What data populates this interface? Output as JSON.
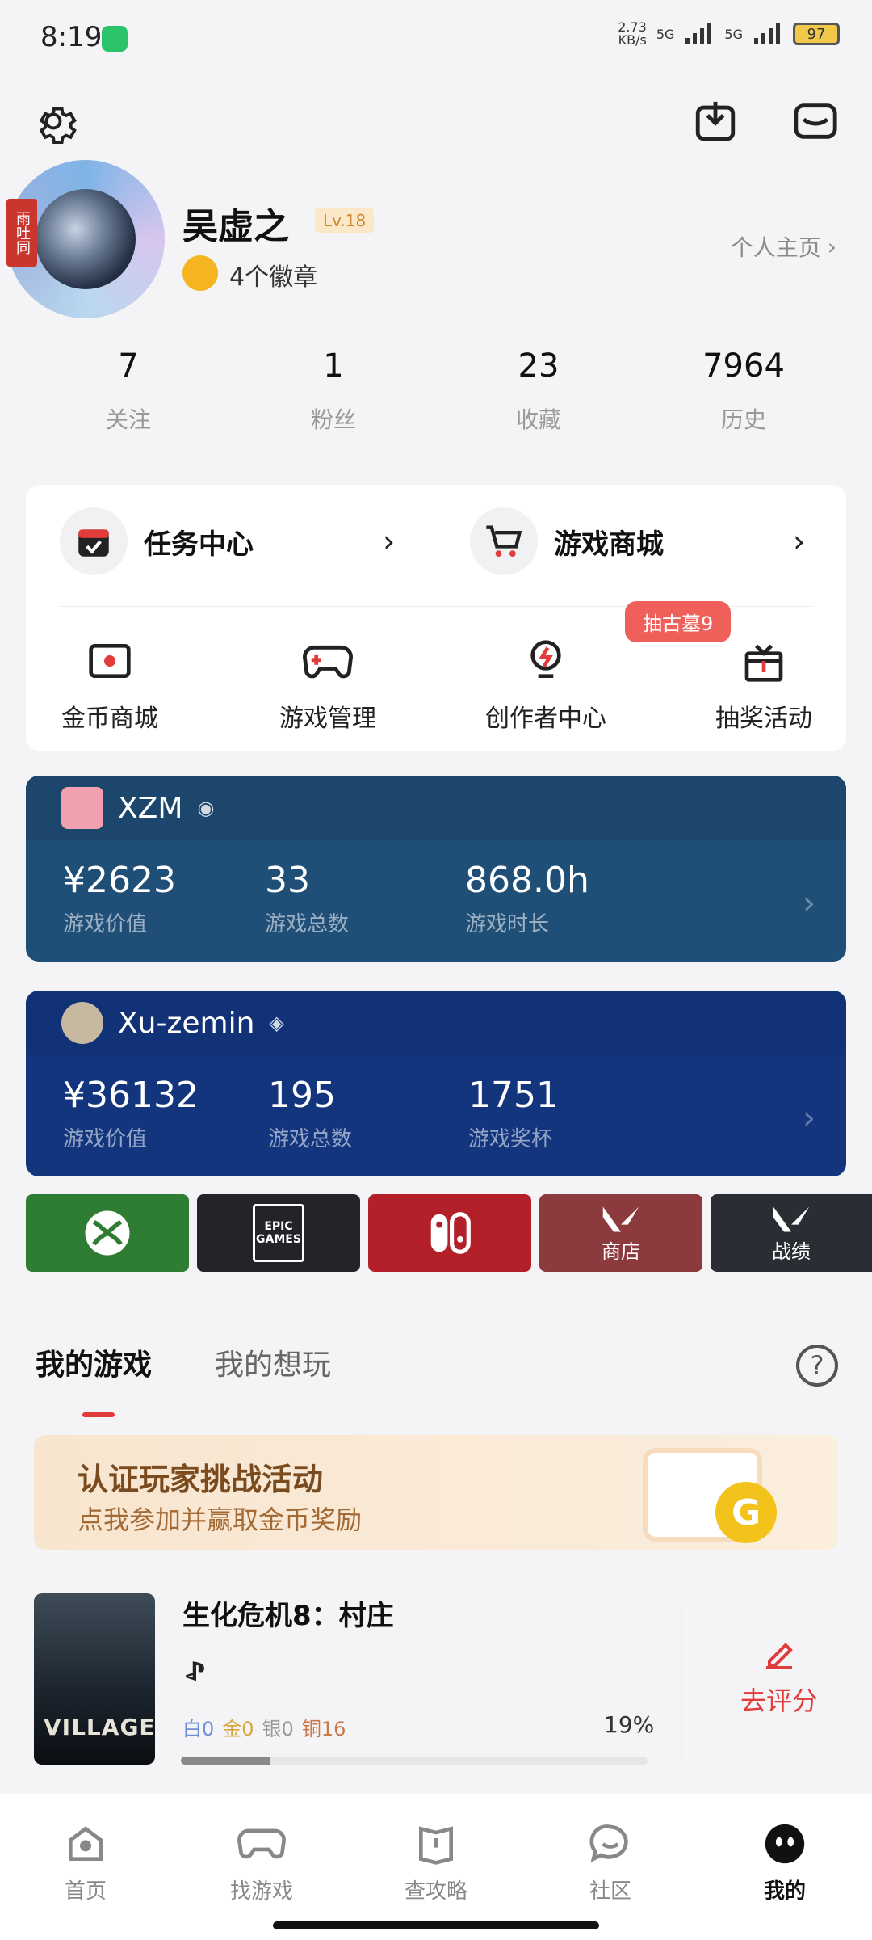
{
  "status_bar": {
    "time": "8:19",
    "net_speed_top": "2.73",
    "net_speed_unit": "KB/s",
    "sim1": "5G",
    "sim2": "5G",
    "battery": "97"
  },
  "profile": {
    "username": "吴虚之",
    "level": "Lv.18",
    "badges": "4个徽章",
    "homepage_link": "个人主页",
    "avatar_badge": "雨吐同"
  },
  "stats": [
    {
      "value": "7",
      "label": "关注"
    },
    {
      "value": "1",
      "label": "粉丝"
    },
    {
      "value": "23",
      "label": "收藏"
    },
    {
      "value": "7964",
      "label": "历史"
    }
  ],
  "entries": [
    {
      "title": "任务中心",
      "icon": "calendar-icon"
    },
    {
      "title": "游戏商城",
      "icon": "cart-icon"
    }
  ],
  "tools": [
    {
      "label": "金币商城",
      "icon": "coin-shop-icon"
    },
    {
      "label": "游戏管理",
      "icon": "gamepad-icon"
    },
    {
      "label": "创作者中心",
      "icon": "bulb-icon"
    },
    {
      "label": "抽奖活动",
      "icon": "gift-icon"
    }
  ],
  "lottery_bubble": "抽古墓9",
  "platforms": {
    "steam": {
      "name": "XZM",
      "color": "#1f4e77",
      "stats": [
        {
          "value": "¥2623",
          "label": "游戏价值"
        },
        {
          "value": "33",
          "label": "游戏总数"
        },
        {
          "value": "868.0h",
          "label": "游戏时长"
        }
      ]
    },
    "psn": {
      "name": "Xu-zemin",
      "color": "#12357e",
      "stats": [
        {
          "value": "¥36132",
          "label": "游戏价值"
        },
        {
          "value": "195",
          "label": "游戏总数"
        },
        {
          "value": "1751",
          "label": "游戏奖杯"
        }
      ]
    }
  },
  "tiles": [
    {
      "name": "xbox",
      "label": "",
      "color": "#2e7d32"
    },
    {
      "name": "epic",
      "label": "EPIC GAMES",
      "color": "#222428"
    },
    {
      "name": "switch",
      "label": "",
      "color": "#b4202a"
    },
    {
      "name": "valorant-shop",
      "label": "商店",
      "color": "#8d3a3f"
    },
    {
      "name": "valorant-record",
      "label": "战绩",
      "color": "#2a2d33"
    }
  ],
  "tabs": [
    {
      "label": "我的游戏",
      "active": true
    },
    {
      "label": "我的想玩",
      "active": false
    }
  ],
  "banner": {
    "title": "认证玩家挑战活动",
    "subtitle": "点我参加并赢取金币奖励",
    "coin_letter": "G"
  },
  "game": {
    "title": "生化危机8：村庄",
    "cover_text": "VILLAGE",
    "trophies": [
      {
        "label": "白0",
        "color": "#6d8fd8"
      },
      {
        "label": "金0",
        "color": "#d6a53a"
      },
      {
        "label": "银0",
        "color": "#9a9a9a"
      },
      {
        "label": "铜16",
        "color": "#c9784a"
      }
    ],
    "progress_text": "19%",
    "progress": 0.19,
    "rate_label": "去评分"
  },
  "nav": [
    {
      "label": "首页",
      "icon": "home-icon"
    },
    {
      "label": "找游戏",
      "icon": "find-game-icon"
    },
    {
      "label": "查攻略",
      "icon": "guide-icon"
    },
    {
      "label": "社区",
      "icon": "community-icon"
    },
    {
      "label": "我的",
      "icon": "me-icon",
      "active": true
    }
  ]
}
